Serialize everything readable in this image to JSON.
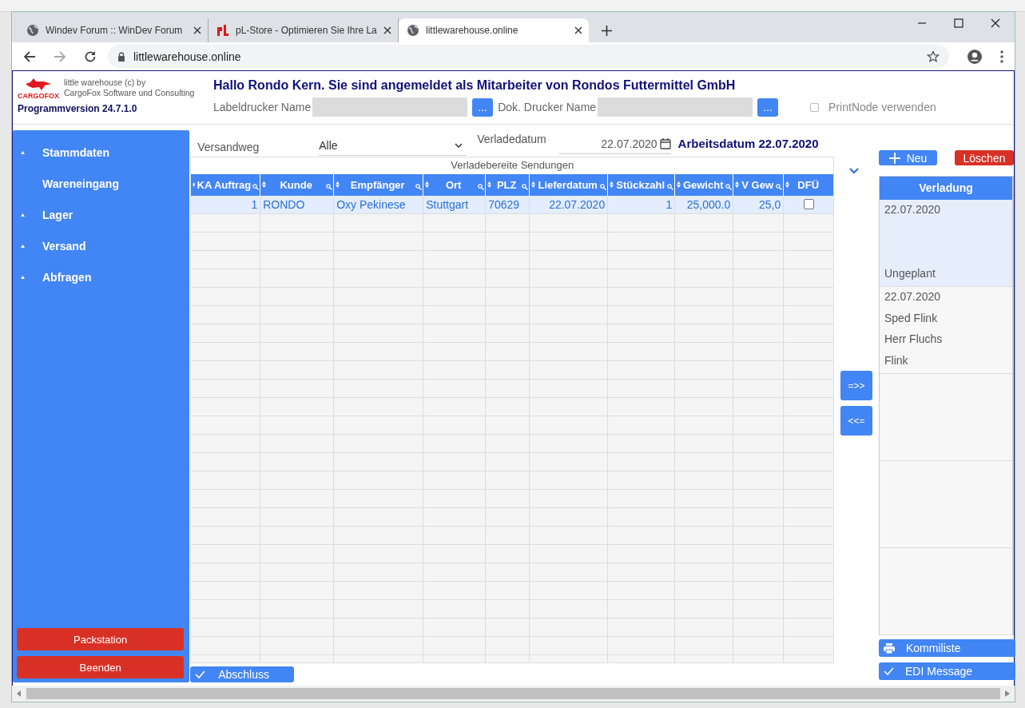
{
  "browser": {
    "tabs": [
      {
        "title": "Windev Forum :: WinDev Forum",
        "selected": false
      },
      {
        "title": "pL-Store - Optimieren Sie Ihre La",
        "selected": false
      },
      {
        "title": "littlewarehouse.online",
        "selected": true
      }
    ],
    "address": "littlewarehouse.online"
  },
  "header": {
    "logo_text": "CARGOFOX",
    "app_name": "little warehouse (c) by",
    "company": "CargoFox Software und Consulting",
    "version": "Programmversion 24.7.1.0",
    "greeting": "Hallo Rondo Kern. Sie sind angemeldet als Mitarbeiter von Rondos Futtermittel GmbH",
    "printers": [
      {
        "label": "Labeldrucker Name",
        "button": "..."
      },
      {
        "label": "Dok. Drucker Name",
        "button": "..."
      }
    ],
    "printnode": {
      "label": "PrintNode verwenden",
      "checked": false,
      "disabled": true
    }
  },
  "sidebar": {
    "items": [
      {
        "label": "Stammdaten",
        "expandable": true
      },
      {
        "label": "Wareneingang",
        "expandable": false
      },
      {
        "label": "Lager",
        "expandable": true
      },
      {
        "label": "Versand",
        "expandable": true
      },
      {
        "label": "Abfragen",
        "expandable": true
      }
    ],
    "buttons": [
      "Packstation",
      "Beenden"
    ]
  },
  "filters": {
    "shipping_label": "Versandweg",
    "shipping_value": "Alle",
    "date_label": "Verladedatum",
    "date_value": "22.07.2020",
    "work_date": "Arbeitsdatum 22.07.2020"
  },
  "table": {
    "title": "Verladebereite Sendungen",
    "columns": [
      {
        "label": "KA Auftrag",
        "searchable": true
      },
      {
        "label": "Kunde",
        "searchable": true
      },
      {
        "label": "Empfänger",
        "searchable": true
      },
      {
        "label": "Ort",
        "searchable": true
      },
      {
        "label": "PLZ",
        "searchable": true
      },
      {
        "label": "Lieferdatum",
        "searchable": true
      },
      {
        "label": "Stückzahl",
        "searchable": true
      },
      {
        "label": "Gewicht",
        "searchable": true
      },
      {
        "label": "V Gew",
        "searchable": true
      },
      {
        "label": "DFÜ",
        "searchable": false
      }
    ],
    "rows": [
      {
        "selected": true,
        "cells": [
          {
            "kind": "number",
            "text": "1"
          },
          {
            "kind": "text",
            "text": "RONDO"
          },
          {
            "kind": "text",
            "text": "Oxy Pekinese"
          },
          {
            "kind": "text",
            "text": "Stuttgart"
          },
          {
            "kind": "text",
            "text": "70629"
          },
          {
            "kind": "number",
            "text": "22.07.2020"
          },
          {
            "kind": "number",
            "text": "1"
          },
          {
            "kind": "number",
            "text": "25,000.0"
          },
          {
            "kind": "number",
            "text": "25,0"
          },
          {
            "kind": "check",
            "checked": false
          }
        ]
      }
    ]
  },
  "finish_button": "Abschluss",
  "transfer_buttons": [
    "=>>",
    "<<="
  ],
  "loadings": {
    "new_button": "Neu",
    "delete_button": "Löschen",
    "header": "Verladung",
    "groups": [
      {
        "selected": true,
        "lines": [
          "22.07.2020",
          "Ungeplant"
        ]
      },
      {
        "selected": false,
        "lines": [
          "22.07.2020",
          "Sped Flink",
          "Herr Fluchs",
          "Flink"
        ]
      }
    ],
    "actions": [
      {
        "label": "Kommiliste"
      },
      {
        "label": "EDI Message"
      }
    ]
  }
}
